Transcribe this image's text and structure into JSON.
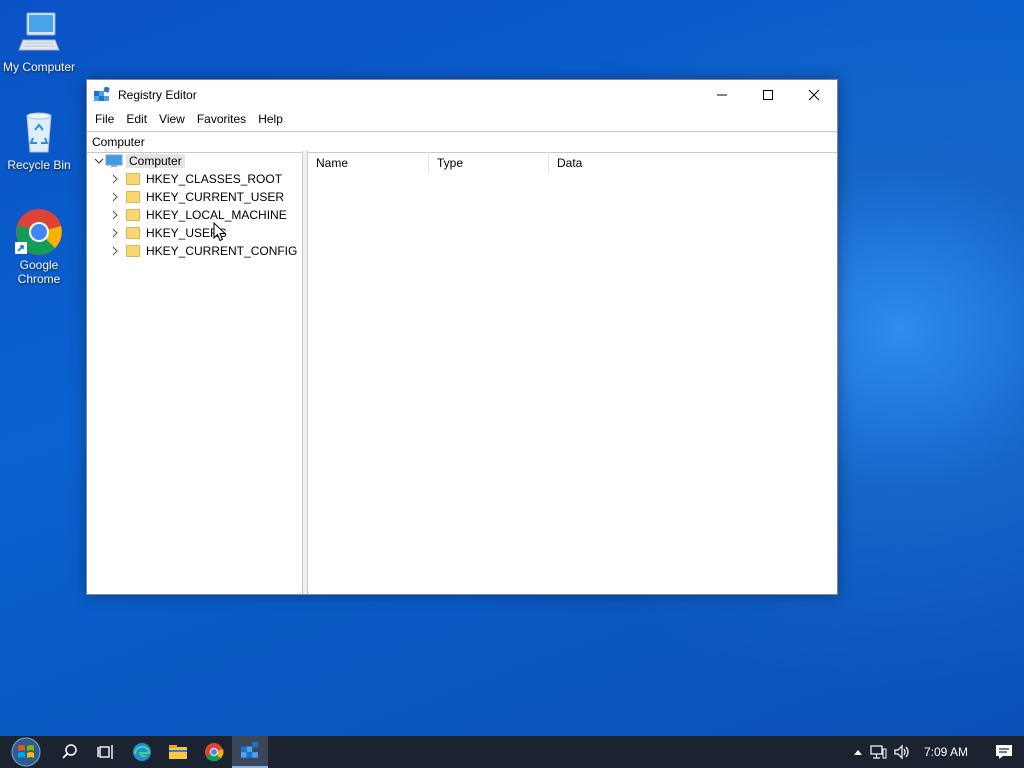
{
  "desktop": {
    "icons": [
      {
        "label": "My Computer",
        "icon": "computer-icon"
      },
      {
        "label": "Recycle Bin",
        "icon": "recycle-bin-icon"
      },
      {
        "label": "Google Chrome",
        "icon": "chrome-icon"
      }
    ]
  },
  "window": {
    "title": "Registry Editor",
    "menu": [
      "File",
      "Edit",
      "View",
      "Favorites",
      "Help"
    ],
    "address": "Computer",
    "tree": {
      "root": "Computer",
      "keys": [
        "HKEY_CLASSES_ROOT",
        "HKEY_CURRENT_USER",
        "HKEY_LOCAL_MACHINE",
        "HKEY_USERS",
        "HKEY_CURRENT_CONFIG"
      ]
    },
    "columns": [
      "Name",
      "Type",
      "Data"
    ]
  },
  "taskbar": {
    "items": [
      "start-button",
      "search-icon",
      "task-view-icon",
      "edge-icon",
      "file-explorer-icon",
      "chrome-icon",
      "registry-editor-icon"
    ],
    "clock": "7:09 AM"
  },
  "colors": {
    "taskbar": "#1c2330",
    "folder": "#f8d775",
    "desktop": "#0a5bc6"
  }
}
